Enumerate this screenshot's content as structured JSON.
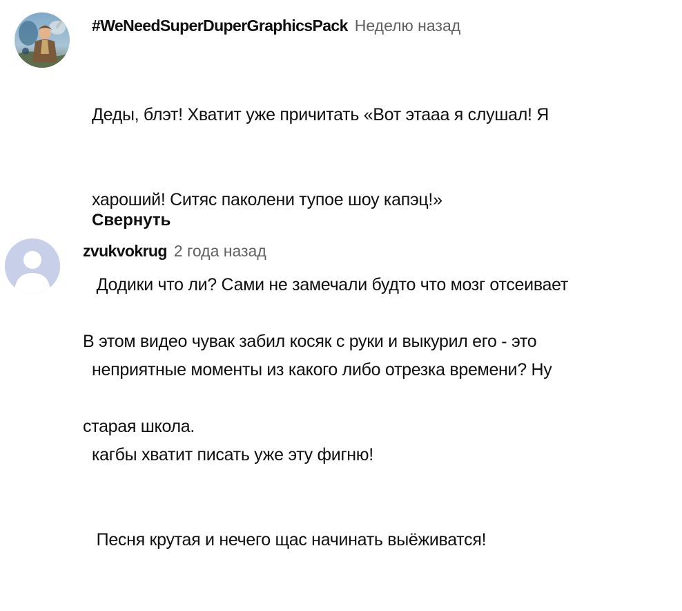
{
  "comments": [
    {
      "author": "#WeNeedSuperDuperGraphicsPack",
      "time": "Неделю назад",
      "avatar_icon": "fantasy-character-avatar-icon",
      "lines": [
        "Деды, блэт! Хватит уже причитать «Вот этааа я слушал! Я",
        "хароший! Ситяс паколени тупое шоу капэц!»",
        " Додики что ли? Сами не замечали будто что мозг отсеивает",
        "неприятные моменты из какого либо отрезка времени? Ну",
        "кагбы хватит писать уже эту фигню!",
        " Песня крутая и нечего щас начинать выёживатся!"
      ],
      "collapse_label": "Свернуть"
    },
    {
      "author": "zvukvokrug",
      "time": "2 года назад",
      "avatar_icon": "default-user-avatar-icon",
      "avatar_color": "#c7cfe9",
      "lines": [
        "В этом видео чувак забил косяк с руки и выкурил его - это",
        "старая школа."
      ]
    }
  ]
}
